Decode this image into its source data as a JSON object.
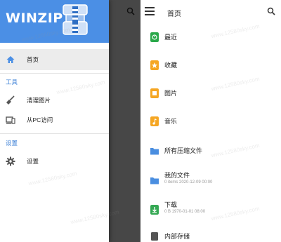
{
  "drawer": {
    "logo": "WINZIP",
    "home_label": "首页",
    "tools_section": "工具",
    "cleanup_label": "清理图片",
    "pc_access_label": "从PC访问",
    "settings_section": "设置",
    "settings_label": "设置"
  },
  "main": {
    "title": "首页",
    "items": [
      {
        "label": "最近"
      },
      {
        "label": "收藏"
      },
      {
        "label": "图片"
      },
      {
        "label": "音乐"
      },
      {
        "label": "所有压缩文件"
      },
      {
        "label": "我的文件",
        "meta": "0 items 2020-12-09 00:00"
      },
      {
        "label": "下载",
        "meta": "0 B 1970-01-01 08:00"
      },
      {
        "label": "内部存储"
      }
    ]
  },
  "watermark": "www.12580sky.com",
  "colors": {
    "header_blue": "#4b8fe5",
    "section_blue": "#3b7fd6",
    "green": "#2aa84a",
    "orange": "#f5a623",
    "folder_blue": "#4a8ee0",
    "download_green": "#34a853"
  }
}
